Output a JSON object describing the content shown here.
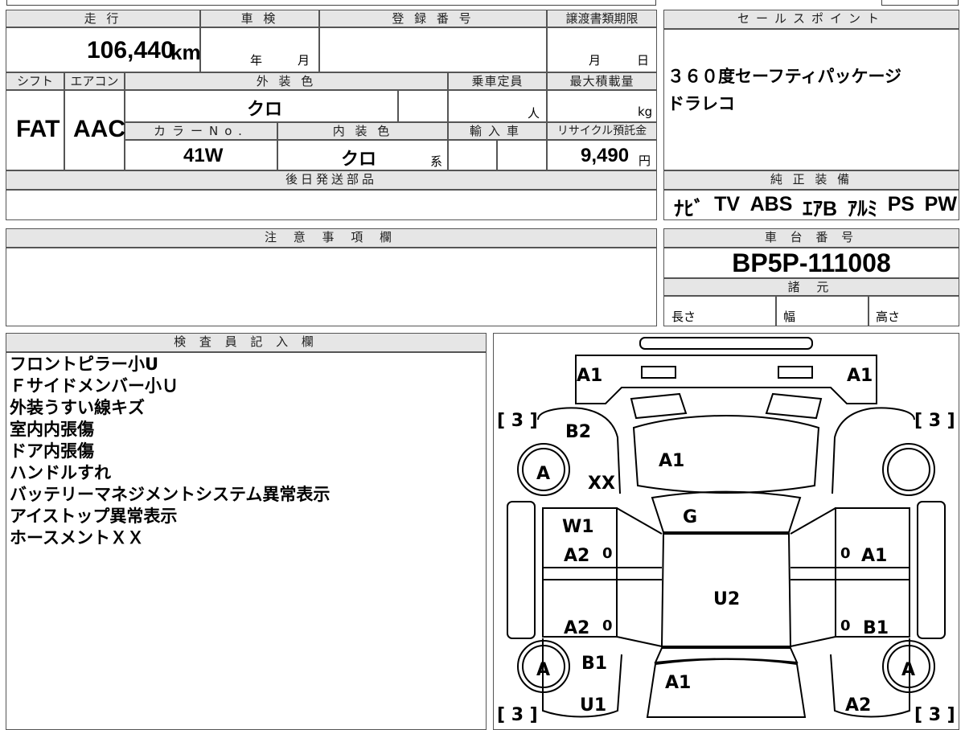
{
  "headers": {
    "mileage": "走 行",
    "shaken": "車 検",
    "registration": "登 録 番 号",
    "transfer_deadline": "譲渡書類期限",
    "sales_point": "セールスポイント",
    "shift": "シフト",
    "aircon": "エアコン",
    "exterior_color": "外 装 色",
    "capacity": "乗車定員",
    "max_load": "最大積載量",
    "color_no": "カラーNo.",
    "interior_color": "内 装 色",
    "import": "輸入車",
    "recycle_fee": "リサイクル預託金",
    "later_parts": "後日発送部品",
    "genuine_equipment": "純 正 装 備",
    "notes": "注 意 事 項 欄",
    "chassis_no": "車 台 番 号",
    "specs": "諸 元",
    "inspector": "検 査 員 記 入 欄"
  },
  "vehicle": {
    "mileage": "106,440",
    "mileage_unit": "km",
    "shaken_year_unit": "年",
    "shaken_month_unit": "月",
    "transfer_month_unit": "月",
    "transfer_day_unit": "日",
    "shift": "FAT",
    "aircon": "AAC",
    "exterior_color": "クロ",
    "capacity_unit": "人",
    "max_load_unit": "kg",
    "color_no": "41W",
    "interior_color": "クロ",
    "interior_suffix": "系",
    "recycle_fee": "9,490",
    "recycle_unit": "円",
    "chassis_no": "BP5P-111008",
    "length_label": "長さ",
    "width_label": "幅",
    "height_label": "高さ"
  },
  "sales_points": [
    "３６０度セーフティパッケージ",
    "ドラレコ"
  ],
  "genuine_equipment": [
    "ﾅﾋﾞ",
    "TV",
    "ABS",
    "ｴｱB",
    "ｱﾙﾐ",
    "PS",
    "PW"
  ],
  "inspector_notes": [
    "フロントピラー小U",
    "Ｆサイドメンバー小Ｕ",
    "外装うすい線キズ",
    "室内内張傷",
    "ドア内張傷",
    "ハンドルすれ",
    "バッテリーマネジメントシステム異常表示",
    "アイストップ異常表示",
    "ホースメントＸＸ"
  ],
  "diagram_marks": {
    "front_left": "A1",
    "front_right": "A1",
    "tire_fl": "[ 3 ]",
    "tire_fr": "[ 3 ]",
    "tire_rl": "[ 3 ]",
    "tire_rr": "[ 3 ]",
    "wheel": "A",
    "fender_fl": "B2",
    "apron_l": "XX",
    "hood": "A1",
    "windshield": "G",
    "roof": "U2",
    "door_fl_1": "W1",
    "door_fl_2": "A2",
    "door_rl": "A2",
    "door_fr": "A1",
    "door_rr": "B1",
    "quarter_rl": "B1",
    "rear_l": "U1",
    "trunk": "A1",
    "rear_r": "A2",
    "zero": "0"
  }
}
